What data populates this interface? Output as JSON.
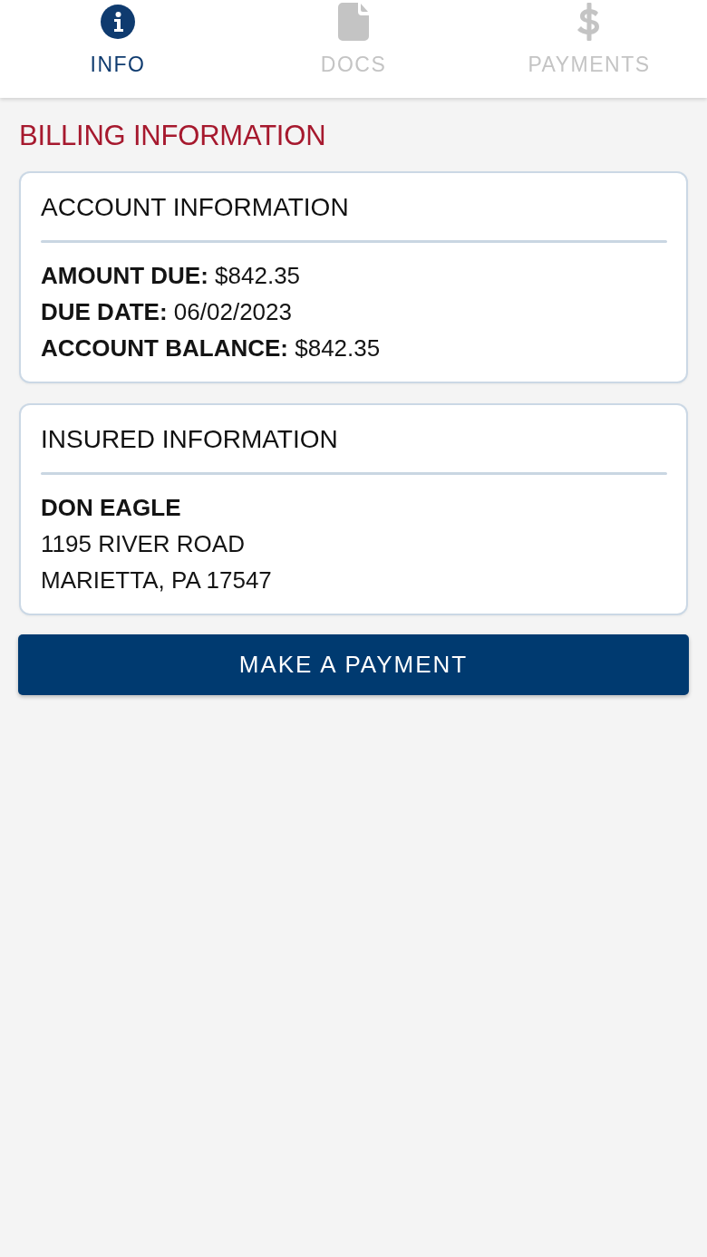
{
  "tabs": [
    {
      "label": "INFO",
      "selected": true
    },
    {
      "label": "DOCS",
      "selected": false
    },
    {
      "label": "PAYMENTS",
      "selected": false
    }
  ],
  "heading": "BILLING INFORMATION",
  "cards": [
    {
      "title": "ACCOUNT INFORMATION",
      "lines": [
        {
          "kind": "field",
          "text": "**AMOUNT DUE:** $842.35"
        },
        {
          "kind": "field",
          "text": "**DUE DATE:** 06/02/2023"
        },
        {
          "kind": "field",
          "text": "**ACCOUNT BALANCE:** $842.35"
        }
      ]
    },
    {
      "title": "INSURED INFORMATION",
      "lines": [
        {
          "kind": "name",
          "text": "DON EAGLE"
        },
        {
          "kind": "plain",
          "text": "1195 RIVER ROAD"
        },
        {
          "kind": "plain",
          "text": "MARIETTA, PA 17547"
        }
      ]
    }
  ],
  "button": "MAKE A PAYMENT"
}
